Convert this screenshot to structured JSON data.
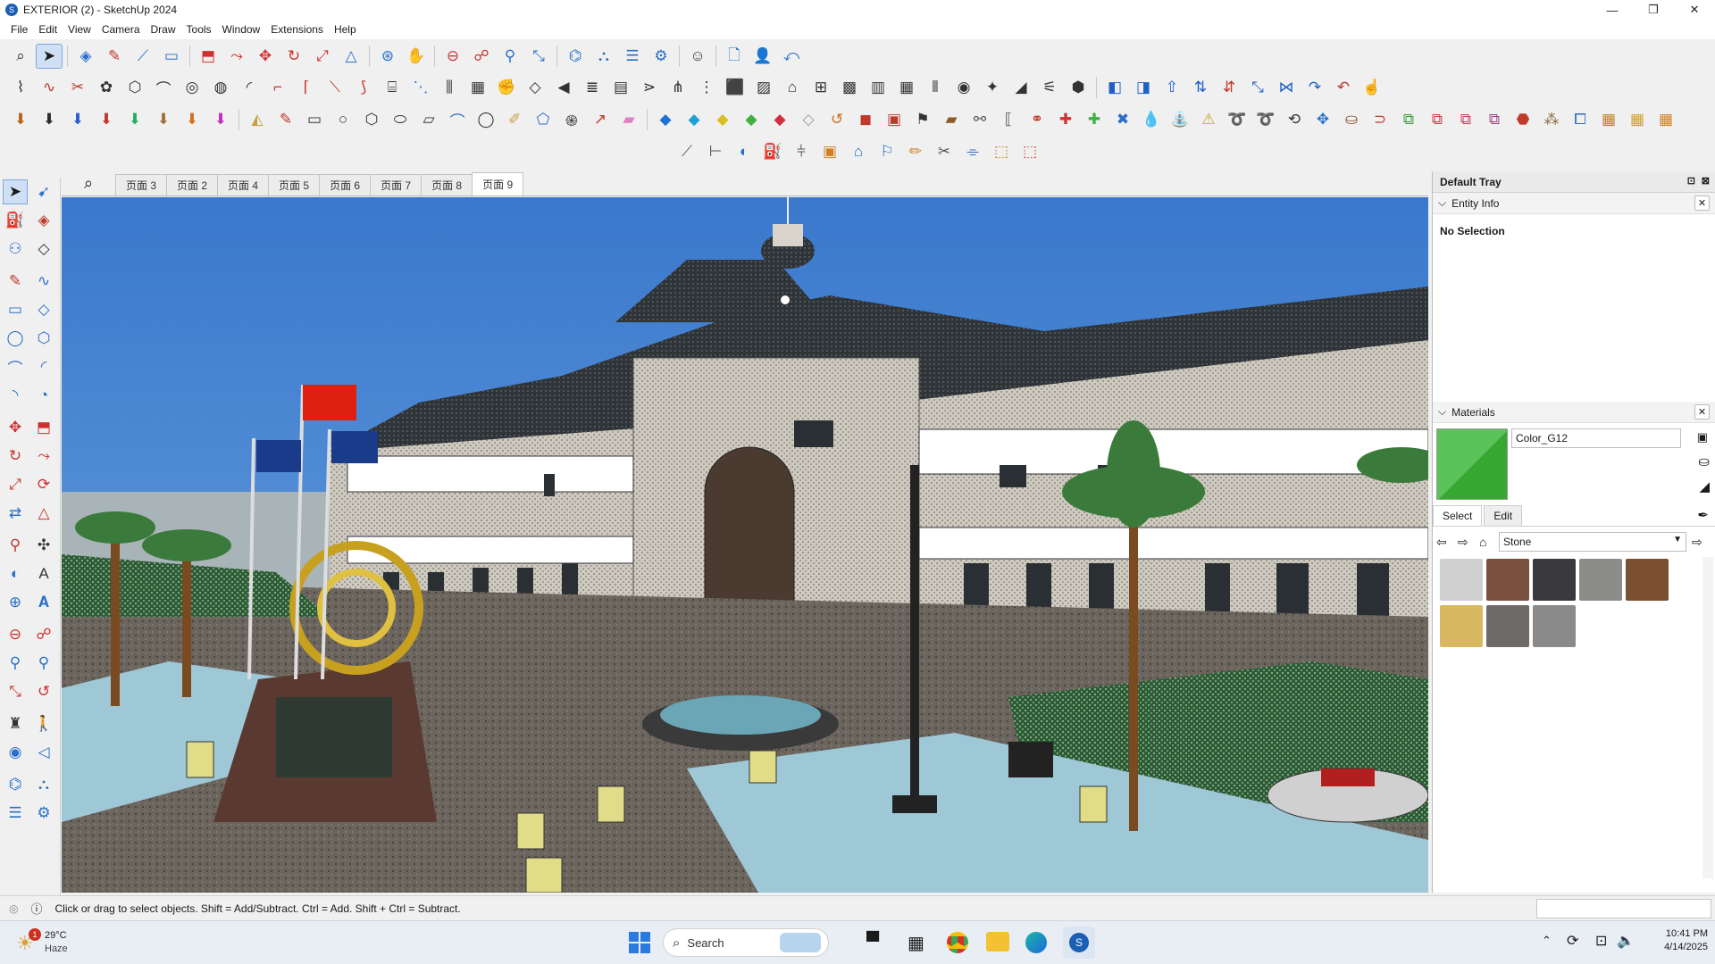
{
  "window": {
    "title": "EXTERIOR  (2) - SketchUp 2024"
  },
  "menu": [
    "File",
    "Edit",
    "View",
    "Camera",
    "Draw",
    "Tools",
    "Window",
    "Extensions",
    "Help"
  ],
  "scene_tabs": [
    "页面 3",
    "页面 2",
    "页面 4",
    "页面 5",
    "页面 6",
    "页面 7",
    "页面 8",
    "页面 9"
  ],
  "active_tab": "页面 9",
  "tray": {
    "title": "Default Tray"
  },
  "entity_info": {
    "title": "Entity Info",
    "value": "No Selection"
  },
  "materials": {
    "title": "Materials",
    "name": "Color_G12",
    "tab_select": "Select",
    "tab_edit": "Edit",
    "library": "Stone",
    "current_color": "#35a832"
  },
  "status": {
    "text": "Click or drag to select objects. Shift = Add/Subtract. Ctrl = Add. Shift + Ctrl = Subtract."
  },
  "taskbar": {
    "weather_temp": "29°C",
    "weather_desc": "Haze",
    "notif_count": "1",
    "search_placeholder": "Search",
    "time": "10:41 PM",
    "date": "4/14/2025"
  }
}
